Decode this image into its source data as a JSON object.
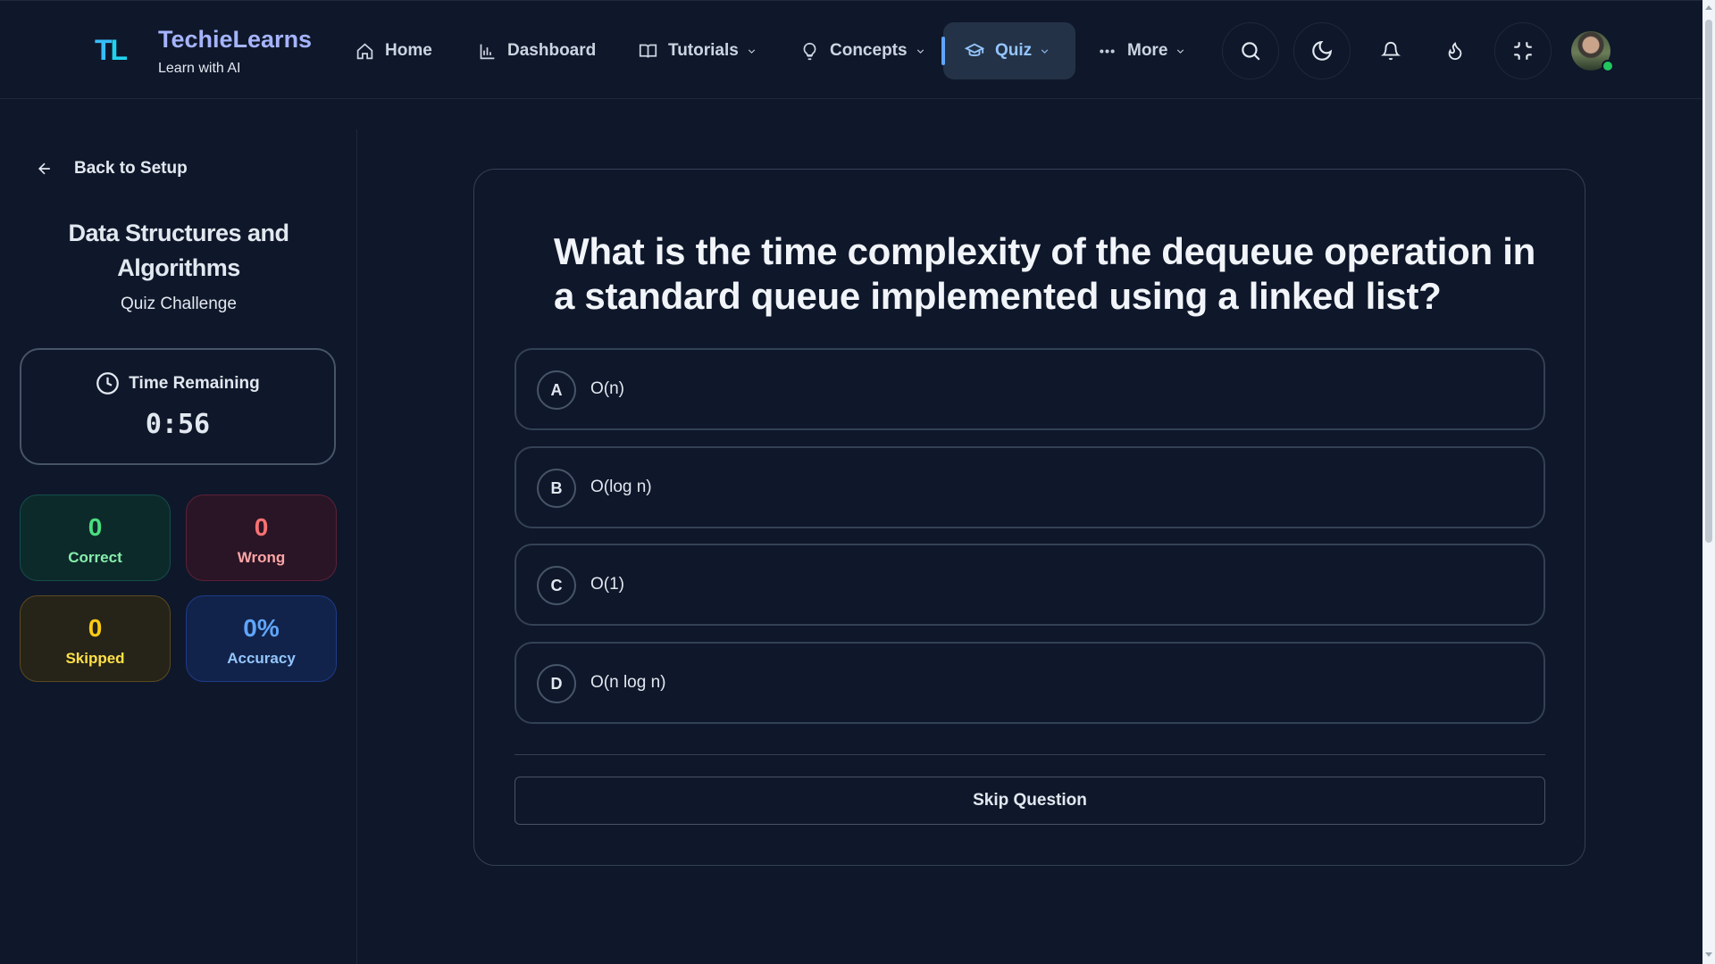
{
  "brand": {
    "logo_text_t": "T",
    "logo_text_l": "L",
    "title": "TechieLearns",
    "subtitle": "Learn with AI"
  },
  "nav": {
    "home": "Home",
    "dashboard": "Dashboard",
    "tutorials": "Tutorials",
    "concepts": "Concepts",
    "quiz": "Quiz",
    "more": "More",
    "active": "Quiz"
  },
  "toolbar_icons": [
    "search-icon",
    "moon-icon",
    "bell-icon",
    "flame-icon",
    "minimize-icon"
  ],
  "sidebar": {
    "back_label": "Back to Setup",
    "quiz_title": "Data Structures and Algorithms",
    "quiz_subtitle": "Quiz Challenge",
    "timer_label": "Time Remaining",
    "timer_value": "0:56",
    "stats": {
      "correct": {
        "value": "0",
        "label": "Correct"
      },
      "wrong": {
        "value": "0",
        "label": "Wrong"
      },
      "skipped": {
        "value": "0",
        "label": "Skipped"
      },
      "accuracy": {
        "value": "0%",
        "label": "Accuracy"
      }
    }
  },
  "question": {
    "text": "What is the time complexity of the dequeue operation in a standard queue implemented using a linked list?",
    "options": [
      {
        "letter": "A",
        "text": "O(n)"
      },
      {
        "letter": "B",
        "text": "O(log n)"
      },
      {
        "letter": "C",
        "text": "O(1)"
      },
      {
        "letter": "D",
        "text": "O(n log n)"
      }
    ],
    "skip_label": "Skip Question"
  },
  "colors": {
    "background": "#0f172a",
    "accent": "#60a5fa",
    "correct": "#4ade80",
    "wrong": "#f87171",
    "skipped": "#facc15",
    "accuracy": "#60a5fa"
  }
}
